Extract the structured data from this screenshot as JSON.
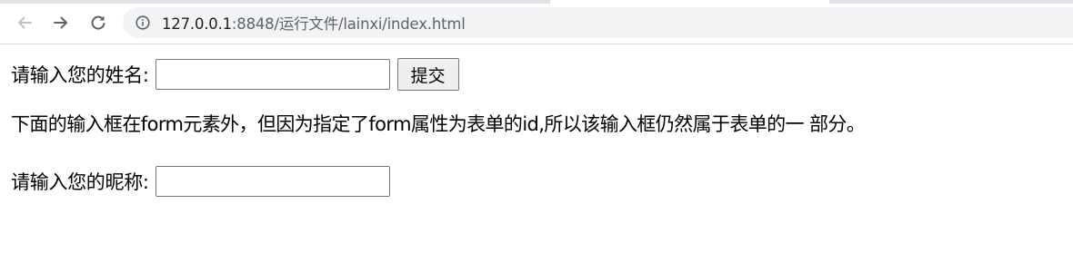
{
  "browser": {
    "back_icon": "arrow-left-icon",
    "forward_icon": "arrow-right-icon",
    "reload_icon": "reload-icon",
    "site_info_icon": "info-circle-icon",
    "url_host": "127.0.0.1",
    "url_rest": ":8848/运行文件/lainxi/index.html"
  },
  "form": {
    "name_label": "请输入您的姓名:",
    "name_value": "",
    "submit_label": "提交"
  },
  "note": {
    "text": "下面的输入框在form元素外，但因为指定了form属性为表单的id,所以该输入框仍然属于表单的一 部分。"
  },
  "outside": {
    "nickname_label": "请输入您的昵称:",
    "nickname_value": ""
  }
}
